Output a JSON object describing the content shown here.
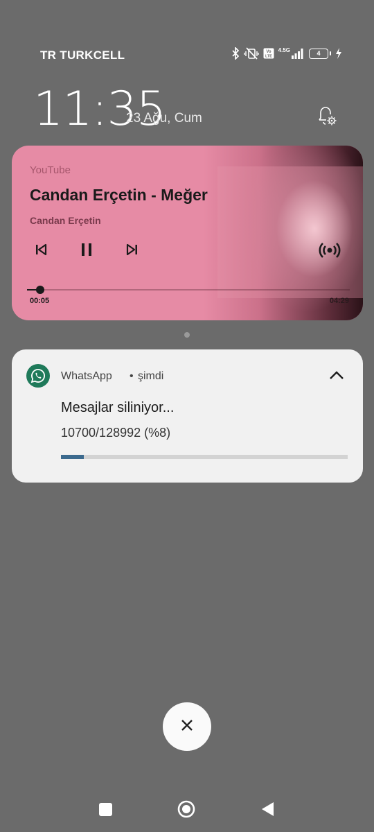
{
  "status_bar": {
    "carrier": "TR TURKCELL",
    "network_label": "4.5G",
    "volte_label": "Vo LTE",
    "battery_level": "4"
  },
  "lockscreen": {
    "time": "11:35",
    "date": "23 Ağu, Cum"
  },
  "media": {
    "source": "YouTube",
    "title": "Candan Erçetin - Meğer",
    "artist": "Candan Erçetin",
    "elapsed": "00:05",
    "total": "04:29",
    "progress_fraction": 0.019,
    "colors": {
      "card": "#e68ba5",
      "text": "#1a1a1a"
    }
  },
  "notification": {
    "app": "WhatsApp",
    "separator": "•",
    "time": "şimdi",
    "title": "Mesajlar siliniyor...",
    "text": "10700/128992 (%8)",
    "progress_percent": 8,
    "colors": {
      "bar": "#3c6a8e",
      "icon": "#1f7a5a"
    }
  },
  "icons": {
    "bluetooth": "bluetooth-icon",
    "mute": "vibrate-off-icon",
    "volte": "volte-icon",
    "signal": "signal-icon",
    "battery": "battery-icon",
    "charging": "charging-bolt-icon",
    "settings": "bell-settings-icon",
    "prev": "skip-previous-icon",
    "pause": "pause-icon",
    "next": "skip-next-icon",
    "cast": "cast-icon",
    "whatsapp": "whatsapp-icon",
    "collapse": "chevron-up-icon",
    "clear": "close-icon"
  }
}
